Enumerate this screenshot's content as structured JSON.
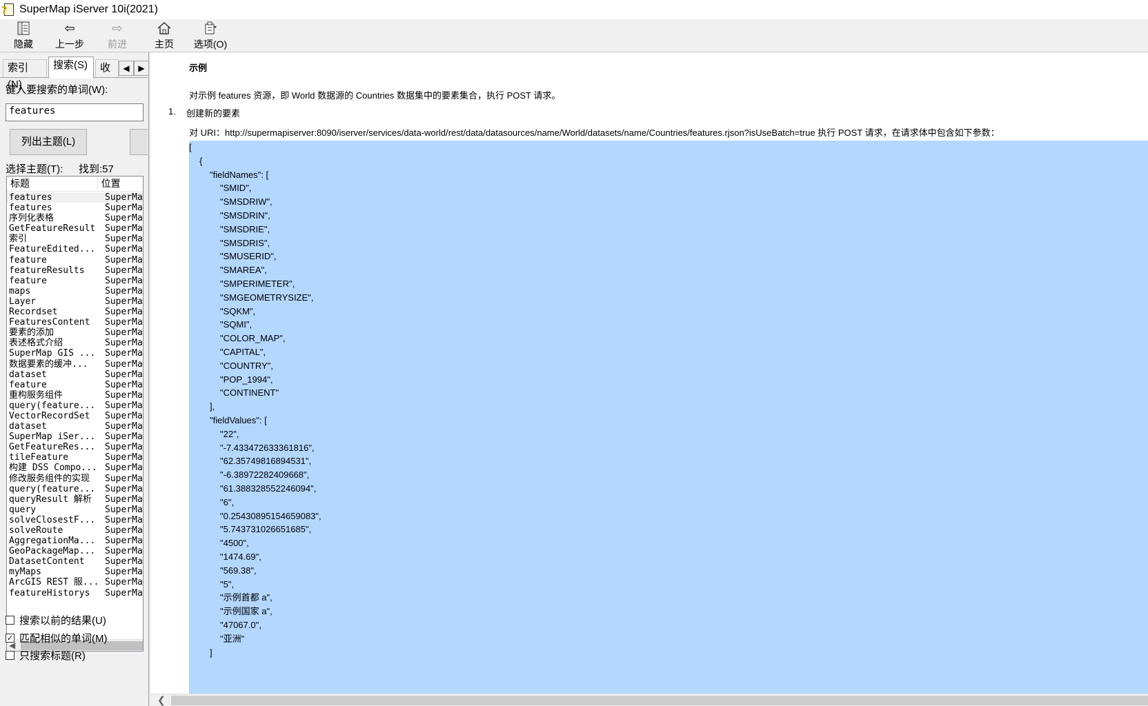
{
  "window": {
    "title": "SuperMap iServer 10i(2021)"
  },
  "toolbar": {
    "hide_label": "隐藏",
    "back_label": "上一步",
    "forward_label": "前进",
    "home_label": "主页",
    "options_label": "选项(O)"
  },
  "left": {
    "tabs": {
      "index": "索引(N)",
      "search": "搜索(S)",
      "favorites": "收"
    },
    "search_prompt": "键入要搜索的单词(W):",
    "search_value": "features",
    "list_button": "列出主题(L)",
    "select_topic": "选择主题(T):",
    "found": "找到:57",
    "header_title": "标题",
    "header_location": "位置",
    "rows": [
      {
        "title": "features",
        "loc": "SuperMa"
      },
      {
        "title": "features",
        "loc": "SuperMa"
      },
      {
        "title": "序列化表格",
        "loc": "SuperMa"
      },
      {
        "title": "GetFeatureResult",
        "loc": "SuperMa"
      },
      {
        "title": "索引",
        "loc": "SuperMa"
      },
      {
        "title": "FeatureEdited...",
        "loc": "SuperMa"
      },
      {
        "title": "feature",
        "loc": "SuperMa"
      },
      {
        "title": "featureResults",
        "loc": "SuperMa"
      },
      {
        "title": "feature",
        "loc": "SuperMa"
      },
      {
        "title": "maps",
        "loc": "SuperMa"
      },
      {
        "title": "Layer",
        "loc": "SuperMa"
      },
      {
        "title": "Recordset",
        "loc": "SuperMa"
      },
      {
        "title": "FeaturesContent",
        "loc": "SuperMa"
      },
      {
        "title": "要素的添加",
        "loc": "SuperMa"
      },
      {
        "title": "表述格式介绍",
        "loc": "SuperMa"
      },
      {
        "title": "SuperMap GIS ...",
        "loc": "SuperMa"
      },
      {
        "title": "数据要素的缓冲...",
        "loc": "SuperMa"
      },
      {
        "title": "dataset",
        "loc": "SuperMa"
      },
      {
        "title": "feature",
        "loc": "SuperMa"
      },
      {
        "title": "重构服务组件",
        "loc": "SuperMa"
      },
      {
        "title": "query(feature...",
        "loc": "SuperMa"
      },
      {
        "title": "VectorRecordSet",
        "loc": "SuperMa"
      },
      {
        "title": "dataset",
        "loc": "SuperMa"
      },
      {
        "title": "SuperMap iSer...",
        "loc": "SuperMa"
      },
      {
        "title": "GetFeatureRes...",
        "loc": "SuperMa"
      },
      {
        "title": "tileFeature",
        "loc": "SuperMa"
      },
      {
        "title": "构建 DSS Compo...",
        "loc": "SuperMa"
      },
      {
        "title": "修改服务组件的实现",
        "loc": "SuperMa"
      },
      {
        "title": "query(feature...",
        "loc": "SuperMa"
      },
      {
        "title": "queryResult 解析",
        "loc": "SuperMa"
      },
      {
        "title": "query",
        "loc": "SuperMa"
      },
      {
        "title": "solveClosestF...",
        "loc": "SuperMa"
      },
      {
        "title": "solveRoute",
        "loc": "SuperMa"
      },
      {
        "title": "AggregationMa...",
        "loc": "SuperMa"
      },
      {
        "title": "GeoPackageMap...",
        "loc": "SuperMa"
      },
      {
        "title": "DatasetContent",
        "loc": "SuperMa"
      },
      {
        "title": "myMaps",
        "loc": "SuperMa"
      },
      {
        "title": "ArcGIS REST 服...",
        "loc": "SuperMa"
      },
      {
        "title": "featureHistorys",
        "loc": "SuperMa"
      }
    ],
    "chk_previous": "搜索以前的结果(U)",
    "chk_similar": "匹配相似的单词(M)",
    "chk_titles": "只搜索标题(R)",
    "chk_similar_mark": "✓"
  },
  "content": {
    "section_title": "示例",
    "intro": "对示例 features 资源，即 World 数据源的 Countries 数据集中的要素集合，执行 POST 请求。",
    "step_num": "1.",
    "step_text": "创建新的要素",
    "uri_line": "对 URI：http://supermapiserver:8090/iserver/services/data-world/rest/data/datasources/name/World/datasets/name/Countries/features.rjson?isUseBatch=true 执行 POST 请求，在请求体中包含如下参数：",
    "code_lines": [
      {
        "indent": 0,
        "text": "["
      },
      {
        "indent": 1,
        "text": "{"
      },
      {
        "indent": 2,
        "text": "\"fieldNames\": ["
      },
      {
        "indent": 3,
        "text": "\"SMID\","
      },
      {
        "indent": 3,
        "text": "\"SMSDRIW\","
      },
      {
        "indent": 3,
        "text": "\"SMSDRIN\","
      },
      {
        "indent": 3,
        "text": "\"SMSDRIE\","
      },
      {
        "indent": 3,
        "text": "\"SMSDRIS\","
      },
      {
        "indent": 3,
        "text": "\"SMUSERID\","
      },
      {
        "indent": 3,
        "text": "\"SMAREA\","
      },
      {
        "indent": 3,
        "text": "\"SMPERIMETER\","
      },
      {
        "indent": 3,
        "text": "\"SMGEOMETRYSIZE\","
      },
      {
        "indent": 3,
        "text": "\"SQKM\","
      },
      {
        "indent": 3,
        "text": "\"SQMI\","
      },
      {
        "indent": 3,
        "text": "\"COLOR_MAP\","
      },
      {
        "indent": 3,
        "text": "\"CAPITAL\","
      },
      {
        "indent": 3,
        "text": "\"COUNTRY\","
      },
      {
        "indent": 3,
        "text": "\"POP_1994\","
      },
      {
        "indent": 3,
        "text": "\"CONTINENT\""
      },
      {
        "indent": 2,
        "text": "],"
      },
      {
        "indent": 2,
        "text": "\"fieldValues\": ["
      },
      {
        "indent": 3,
        "text": "\"22\","
      },
      {
        "indent": 3,
        "text": "\"-7.433472633361816\","
      },
      {
        "indent": 3,
        "text": "\"62.35749816894531\","
      },
      {
        "indent": 3,
        "text": "\"-6.38972282409668\","
      },
      {
        "indent": 3,
        "text": "\"61.388328552246094\","
      },
      {
        "indent": 3,
        "text": "\"6\","
      },
      {
        "indent": 3,
        "text": "\"0.25430895154659083\","
      },
      {
        "indent": 3,
        "text": "\"5.743731026651685\","
      },
      {
        "indent": 3,
        "text": "\"4500\","
      },
      {
        "indent": 3,
        "text": "\"1474.69\","
      },
      {
        "indent": 3,
        "text": "\"569.38\","
      },
      {
        "indent": 3,
        "text": "\"5\","
      },
      {
        "indent": 3,
        "text": "\"示例首都 a\","
      },
      {
        "indent": 3,
        "text": "\"示例国家 a\","
      },
      {
        "indent": 3,
        "text": "\"47067.0\","
      },
      {
        "indent": 3,
        "text": "\"亚洲\""
      },
      {
        "indent": 2,
        "text": "]"
      }
    ]
  },
  "colors": {
    "selection": "#b3d7ff",
    "chrome": "#f0f0f0"
  },
  "icons": {
    "hide": "hide-pane-icon",
    "back": "back-arrow-icon",
    "forward": "forward-arrow-icon",
    "home": "home-icon",
    "options": "options-icon"
  }
}
